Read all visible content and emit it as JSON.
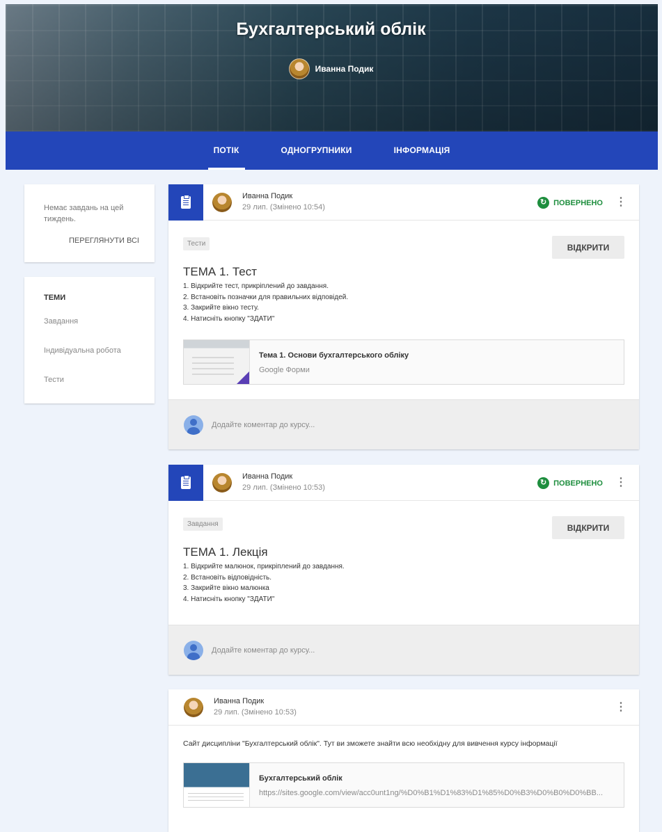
{
  "header": {
    "course_title": "Бухгалтерський облік",
    "teacher_name": "Иванна Подик"
  },
  "nav": {
    "tabs": [
      {
        "label": "ПОТІК",
        "active": true
      },
      {
        "label": "ОДНОГРУПНИКИ",
        "active": false
      },
      {
        "label": "ІНФОРМАЦІЯ",
        "active": false
      }
    ]
  },
  "sidebar": {
    "upcoming_text": "Немає завдань на цей тиждень.",
    "view_all_label": "ПЕРЕГЛЯНУТИ ВСІ",
    "topics_title": "ТЕМИ",
    "topics": [
      "Завдання",
      "Індивідуальна робота",
      "Тести"
    ]
  },
  "posts": [
    {
      "author": "Иванна Подик",
      "date": "29 лип. (Змінено 10:54)",
      "status": "ПОВЕРНЕНО",
      "topic_chip": "Тести",
      "open_label": "ВІДКРИТИ",
      "title": "ТЕМА 1. Тест",
      "steps": [
        "1. Відкрийте тест, прикріплений до завдання.",
        "2. Встановіть позначки для правильних відповідей.",
        "3. Закрийте вікно тесту.",
        "4. Натисніть кнопку \"ЗДАТИ\""
      ],
      "attachment": {
        "title": "Тема 1. Основи бухгалтерського обліку",
        "subtitle": "Google Форми"
      },
      "comment_placeholder": "Додайте коментар до курсу..."
    },
    {
      "author": "Иванна Подик",
      "date": "29 лип. (Змінено 10:53)",
      "status": "ПОВЕРНЕНО",
      "topic_chip": "Завдання",
      "open_label": "ВІДКРИТИ",
      "title": "ТЕМА 1. Лекція",
      "steps": [
        "1. Відкрийте малюнок, прикріплений до завдання.",
        "2. Встановіть відповідність.",
        "3. Закрийте вікно малюнка",
        "4. Натисніть кнопку \"ЗДАТИ\""
      ],
      "comment_placeholder": "Додайте коментар до курсу..."
    },
    {
      "author": "Иванна Подик",
      "date": "29 лип. (Змінено 10:53)",
      "text": "Сайт дисципліни \"Бухгалтерський облік\". Тут ви зможете знайти всю необхідну для вивчення курсу інформації",
      "attachment": {
        "title": "Бухгалтерський облік",
        "subtitle": "https://sites.google.com/view/acc0unt1ng/%D0%B1%D1%83%D1%85%D0%B3%D0%B0%D0%BB..."
      }
    }
  ]
}
